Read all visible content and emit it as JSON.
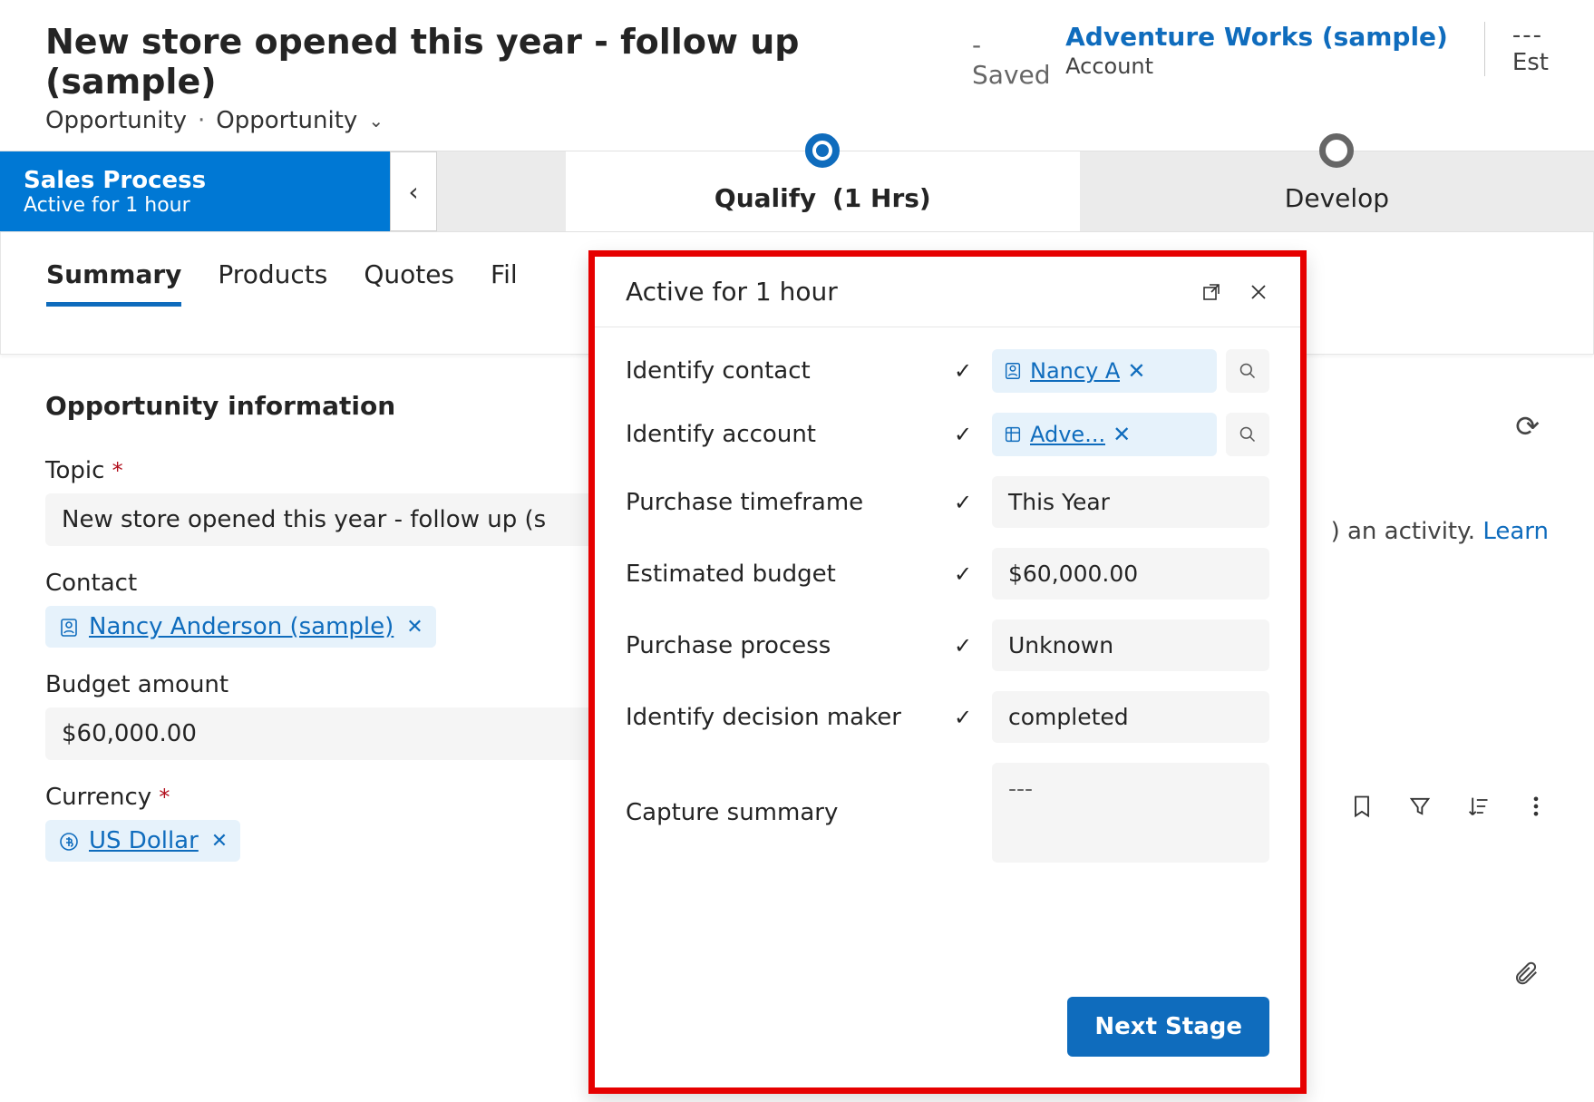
{
  "header": {
    "title": "New store opened this year - follow up (sample)",
    "saved_suffix": "- Saved",
    "entity": "Opportunity",
    "form_selector": "Opportunity",
    "account_link": "Adventure Works (sample)",
    "account_label": "Account",
    "est_value": "---",
    "est_label": "Est"
  },
  "bpf": {
    "name": "Sales Process",
    "duration": "Active for 1 hour",
    "stages": [
      {
        "label": "Qualify",
        "duration": "(1 Hrs)",
        "active": true
      },
      {
        "label": "Develop",
        "duration": "",
        "active": false
      }
    ]
  },
  "tabs": [
    "Summary",
    "Products",
    "Quotes",
    "Fil"
  ],
  "form": {
    "section_title": "Opportunity information",
    "fields": {
      "topic": {
        "label": "Topic",
        "required": true,
        "value": "New store opened this year - follow up (s"
      },
      "contact": {
        "label": "Contact",
        "value": "Nancy Anderson (sample)"
      },
      "budget": {
        "label": "Budget amount",
        "value": "$60,000.00"
      },
      "currency": {
        "label": "Currency",
        "required": true,
        "value": "US Dollar"
      }
    }
  },
  "right": {
    "activity_hint_suffix": "an activity.",
    "learn": "Learn"
  },
  "flyout": {
    "title": "Active for 1 hour",
    "rows": [
      {
        "label": "Identify contact",
        "checked": true,
        "type": "lookup",
        "value": "Nancy A",
        "icon": "contact"
      },
      {
        "label": "Identify account",
        "checked": true,
        "type": "lookup",
        "value": "Adve...",
        "icon": "account"
      },
      {
        "label": "Purchase timeframe",
        "checked": true,
        "type": "text",
        "value": "This Year"
      },
      {
        "label": "Estimated budget",
        "checked": true,
        "type": "text",
        "value": "$60,000.00"
      },
      {
        "label": "Purchase process",
        "checked": true,
        "type": "text",
        "value": "Unknown"
      },
      {
        "label": "Identify decision maker",
        "checked": true,
        "type": "text",
        "value": "completed"
      },
      {
        "label": "Capture summary",
        "checked": false,
        "type": "summary",
        "value": "---"
      }
    ],
    "next_stage": "Next Stage"
  }
}
